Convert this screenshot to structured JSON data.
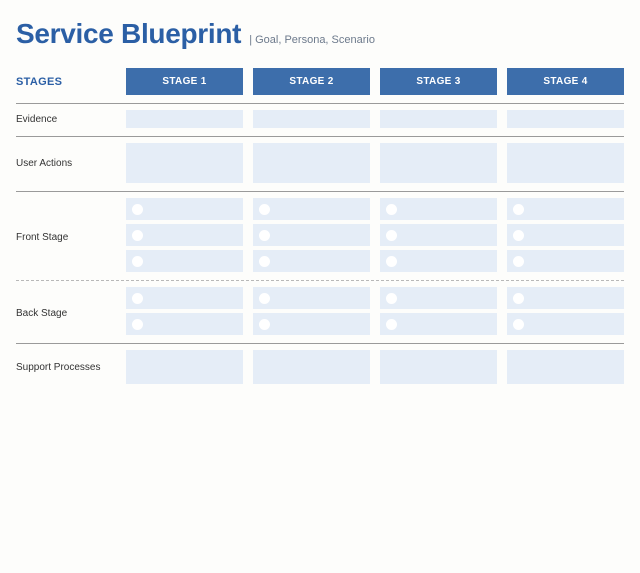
{
  "header": {
    "title": "Service Blueprint",
    "subtitle": "| Goal, Persona, Scenario"
  },
  "stages_label": "STAGES",
  "stages": [
    "STAGE 1",
    "STAGE 2",
    "STAGE 3",
    "STAGE 4"
  ],
  "rows": {
    "evidence": "Evidence",
    "user_actions": "User Actions",
    "front_stage": "Front Stage",
    "back_stage": "Back Stage",
    "support": "Support Processes"
  }
}
